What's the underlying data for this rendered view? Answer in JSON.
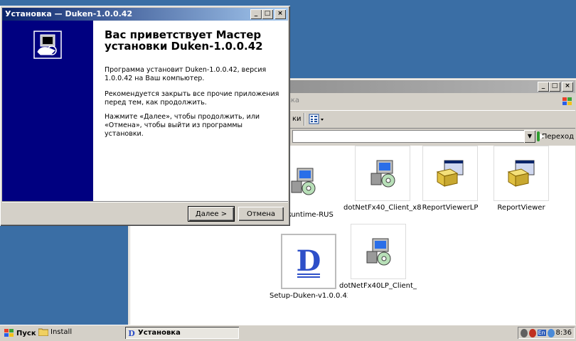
{
  "installer": {
    "title": "Установка — Duken-1.0.0.42",
    "heading": "Вас приветствует Мастер установки Duken-1.0.0.42",
    "para1": "Программа установит Duken-1.0.0.42, версия 1.0.0.42 на Ваш компьютер.",
    "para2": "Рекомендуется закрыть все прочие приложения перед тем, как продолжить.",
    "para3": "Нажмите «Далее», чтобы продолжить, или «Отмена», чтобы выйти из программы установки.",
    "next_label": "Далее >",
    "cancel_label": "Отмена",
    "sidebar_color": "#000080"
  },
  "explorer": {
    "menu_partial": "вка",
    "toolbar_partial": "ки",
    "go_label": "Переход",
    "files": [
      {
        "name": "SCERuntime-RUS",
        "icon": "installer-package-icon"
      },
      {
        "name": "dotNetFx40_Client_x8...",
        "icon": "installer-package-icon"
      },
      {
        "name": "ReportViewerLP",
        "icon": "setup-box-icon"
      },
      {
        "name": "ReportViewer",
        "icon": "setup-box-icon"
      },
      {
        "name": "Setup-Duken-v1.0.0.42",
        "icon": "duken-d-icon"
      },
      {
        "name": "dotNetFx40LP_Client_...",
        "icon": "installer-package-icon"
      }
    ]
  },
  "taskbar": {
    "start_label": "Пуск",
    "quick_label": "Install",
    "task_label": "Установка",
    "lang": "En",
    "clock": "8:36"
  }
}
